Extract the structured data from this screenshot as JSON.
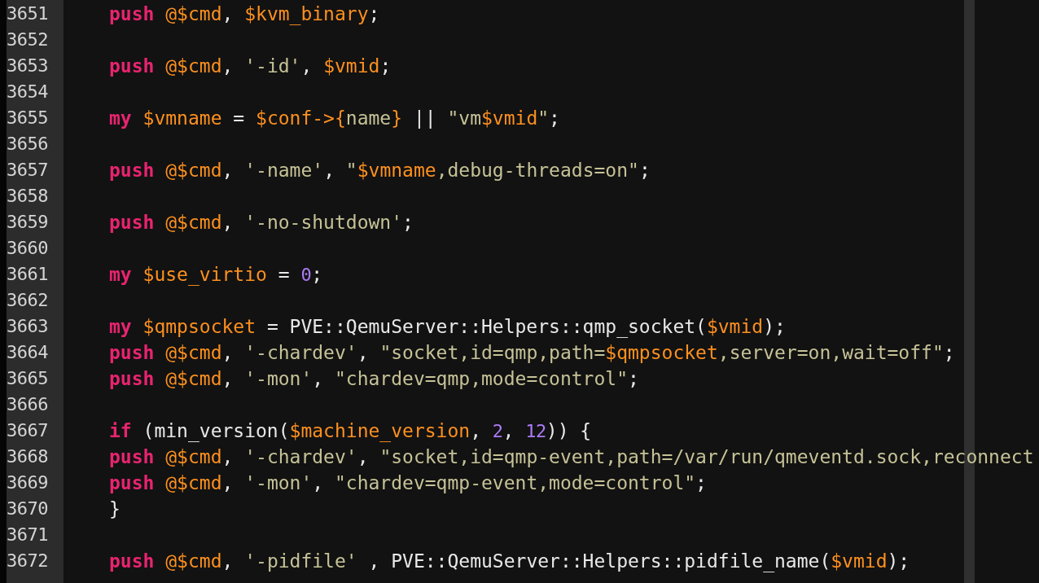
{
  "editor": {
    "lines": [
      {
        "number": "3651",
        "tokens": [
          {
            "kind": "keyword",
            "text": "push"
          },
          {
            "kind": "variable",
            "text": " @$cmd"
          },
          {
            "kind": "plain",
            "text": ", "
          },
          {
            "kind": "variable",
            "text": "$kvm_binary"
          },
          {
            "kind": "plain",
            "text": ";"
          }
        ]
      },
      {
        "number": "3652"
      },
      {
        "number": "3653",
        "tokens": [
          {
            "kind": "keyword",
            "text": "push"
          },
          {
            "kind": "variable",
            "text": " @$cmd"
          },
          {
            "kind": "plain",
            "text": ", "
          },
          {
            "kind": "string",
            "text": "'-id'"
          },
          {
            "kind": "plain",
            "text": ", "
          },
          {
            "kind": "variable",
            "text": "$vmid"
          },
          {
            "kind": "plain",
            "text": ";"
          }
        ]
      },
      {
        "number": "3654"
      },
      {
        "number": "3655",
        "tokens": [
          {
            "kind": "keyword",
            "text": "my"
          },
          {
            "kind": "variable",
            "text": " $vmname"
          },
          {
            "kind": "plain",
            "text": " = "
          },
          {
            "kind": "variable",
            "text": "$conf->{"
          },
          {
            "kind": "string",
            "text": "name"
          },
          {
            "kind": "variable",
            "text": "}"
          },
          {
            "kind": "plain",
            "text": " || "
          },
          {
            "kind": "string",
            "text": "\"vm"
          },
          {
            "kind": "variable",
            "text": "$vmid"
          },
          {
            "kind": "string",
            "text": "\""
          },
          {
            "kind": "plain",
            "text": ";"
          }
        ]
      },
      {
        "number": "3656"
      },
      {
        "number": "3657",
        "tokens": [
          {
            "kind": "keyword",
            "text": "push"
          },
          {
            "kind": "variable",
            "text": " @$cmd"
          },
          {
            "kind": "plain",
            "text": ", "
          },
          {
            "kind": "string",
            "text": "'-name'"
          },
          {
            "kind": "plain",
            "text": ", "
          },
          {
            "kind": "string",
            "text": "\""
          },
          {
            "kind": "variable",
            "text": "$vmname"
          },
          {
            "kind": "string",
            "text": ",debug-threads=on\""
          },
          {
            "kind": "plain",
            "text": ";"
          }
        ]
      },
      {
        "number": "3658"
      },
      {
        "number": "3659",
        "tokens": [
          {
            "kind": "keyword",
            "text": "push"
          },
          {
            "kind": "variable",
            "text": " @$cmd"
          },
          {
            "kind": "plain",
            "text": ", "
          },
          {
            "kind": "string",
            "text": "'-no-shutdown'"
          },
          {
            "kind": "plain",
            "text": ";"
          }
        ]
      },
      {
        "number": "3660"
      },
      {
        "number": "3661",
        "tokens": [
          {
            "kind": "keyword",
            "text": "my"
          },
          {
            "kind": "variable",
            "text": " $use_virtio"
          },
          {
            "kind": "plain",
            "text": " = "
          },
          {
            "kind": "number",
            "text": "0"
          },
          {
            "kind": "plain",
            "text": ";"
          }
        ]
      },
      {
        "number": "3662"
      },
      {
        "number": "3663",
        "tokens": [
          {
            "kind": "keyword",
            "text": "my"
          },
          {
            "kind": "variable",
            "text": " $qmpsocket"
          },
          {
            "kind": "plain",
            "text": " = PVE::QemuServer::Helpers::qmp_socket("
          },
          {
            "kind": "variable",
            "text": "$vmid"
          },
          {
            "kind": "plain",
            "text": ");"
          }
        ]
      },
      {
        "number": "3664",
        "tokens": [
          {
            "kind": "keyword",
            "text": "push"
          },
          {
            "kind": "variable",
            "text": " @$cmd"
          },
          {
            "kind": "plain",
            "text": ", "
          },
          {
            "kind": "string",
            "text": "'-chardev'"
          },
          {
            "kind": "plain",
            "text": ", "
          },
          {
            "kind": "string",
            "text": "\"socket,id=qmp,path="
          },
          {
            "kind": "variable",
            "text": "$qmpsocket"
          },
          {
            "kind": "string",
            "text": ",server=on,wait=off\""
          },
          {
            "kind": "plain",
            "text": ";"
          }
        ]
      },
      {
        "number": "3665",
        "tokens": [
          {
            "kind": "keyword",
            "text": "push"
          },
          {
            "kind": "variable",
            "text": " @$cmd"
          },
          {
            "kind": "plain",
            "text": ", "
          },
          {
            "kind": "string",
            "text": "'-mon'"
          },
          {
            "kind": "plain",
            "text": ", "
          },
          {
            "kind": "string",
            "text": "\"chardev=qmp,mode=control\""
          },
          {
            "kind": "plain",
            "text": ";"
          }
        ]
      },
      {
        "number": "3666"
      },
      {
        "number": "3667",
        "tokens": [
          {
            "kind": "keyword",
            "text": "if"
          },
          {
            "kind": "plain",
            "text": " (min_version("
          },
          {
            "kind": "variable",
            "text": "$machine_version"
          },
          {
            "kind": "plain",
            "text": ", "
          },
          {
            "kind": "number",
            "text": "2"
          },
          {
            "kind": "plain",
            "text": ", "
          },
          {
            "kind": "number",
            "text": "12"
          },
          {
            "kind": "plain",
            "text": ")) {"
          }
        ]
      },
      {
        "number": "3668",
        "tokens": [
          {
            "kind": "keyword",
            "text": "push"
          },
          {
            "kind": "variable",
            "text": " @$cmd"
          },
          {
            "kind": "plain",
            "text": ", "
          },
          {
            "kind": "string",
            "text": "'-chardev'"
          },
          {
            "kind": "plain",
            "text": ", "
          },
          {
            "kind": "string",
            "text": "\"socket,id=qmp-event,path=/var/run/qmeventd.sock,reconnect"
          }
        ]
      },
      {
        "number": "3669",
        "tokens": [
          {
            "kind": "keyword",
            "text": "push"
          },
          {
            "kind": "variable",
            "text": " @$cmd"
          },
          {
            "kind": "plain",
            "text": ", "
          },
          {
            "kind": "string",
            "text": "'-mon'"
          },
          {
            "kind": "plain",
            "text": ", "
          },
          {
            "kind": "string",
            "text": "\"chardev=qmp-event,mode=control\""
          },
          {
            "kind": "plain",
            "text": ";"
          }
        ]
      },
      {
        "number": "3670",
        "tokens": [
          {
            "kind": "plain",
            "text": "}"
          }
        ]
      },
      {
        "number": "3671"
      },
      {
        "number": "3672",
        "tokens": [
          {
            "kind": "keyword",
            "text": "push"
          },
          {
            "kind": "variable",
            "text": " @$cmd"
          },
          {
            "kind": "plain",
            "text": ", "
          },
          {
            "kind": "string",
            "text": "'-pidfile'"
          },
          {
            "kind": "plain",
            "text": " , PVE::QemuServer::Helpers::pidfile_name("
          },
          {
            "kind": "variable",
            "text": "$vmid"
          },
          {
            "kind": "plain",
            "text": ");"
          }
        ]
      }
    ]
  }
}
